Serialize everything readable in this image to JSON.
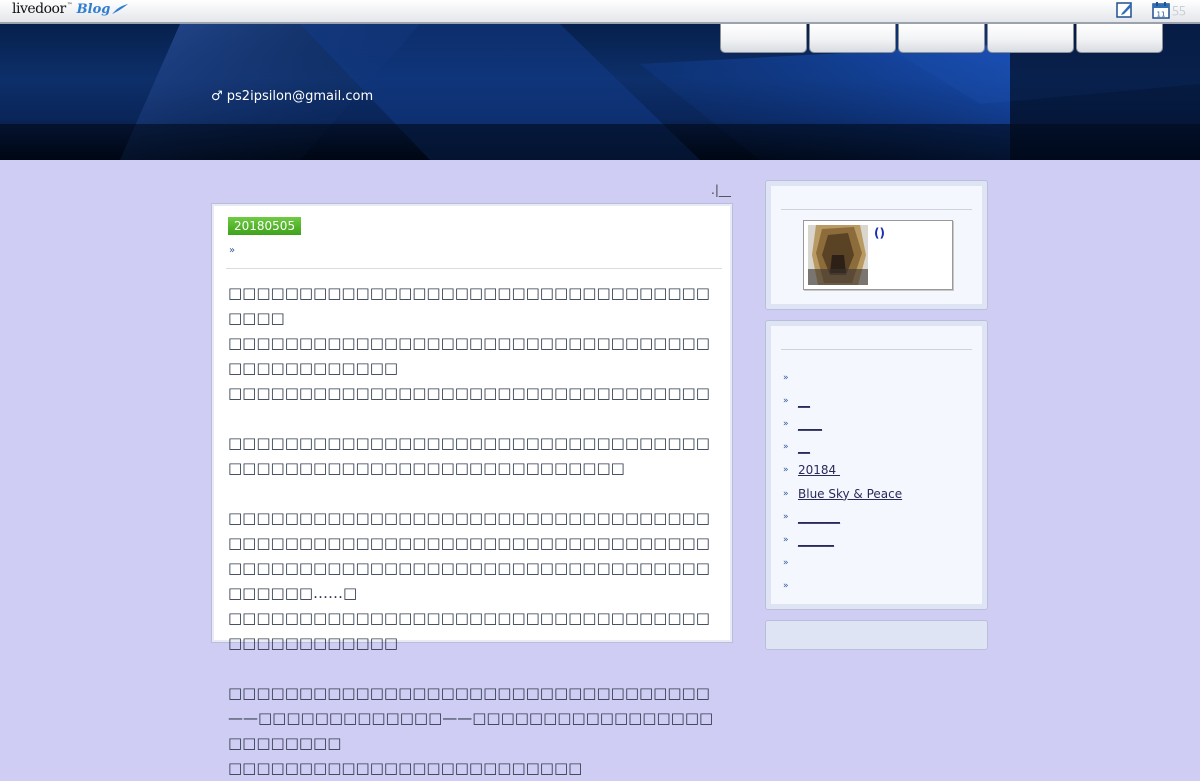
{
  "topbar": {
    "logo_main": "livedoor",
    "logo_tm": "™",
    "logo_blog": "Blog",
    "edit_icon": "edit-icon",
    "calendar_icon": "calendar-icon",
    "calendar_day": "11",
    "faded_text": "ƽƽ"
  },
  "header": {
    "email": "♂ ps2ipsilon@gmail.com",
    "nav_tabs": [
      "",
      "",
      "",
      "",
      ""
    ]
  },
  "breadcrumb": ".|__",
  "article": {
    "date": "20180505",
    "title_marker": "»",
    "paragraphs": [
      "□□□□□□□□□□□□□□□□□□□□□□□□□□□□□□□□□□□□□□\n□□□□□□□□□□□□□□□□□□□□□□□□□□□□□□□□□□□□□□□□□□□□□□\n□□□□□□□□□□□□□□□□□□□□□□□□□□□□□□□□□□",
      "□□□□□□□□□□□□□□□□□□□□□□□□□□□□□□□□□□□□□□□□□□□□□□□□□□□□□□□□□□□□□□",
      "□□□□□□□□□□□□□□□□□□□□□□□□□□□□□□□□□□□□□□□□□□□□□□□□□□□□□□□□□□□□□□□□□□□□□□□□□□□□□□□□□□□□□□□□□□□□□□□□□□□□□□□□□□□□……□\n□□□□□□□□□□□□□□□□□□□□□□□□□□□□□□□□□□□□□□□□□□□□□□",
      "□□□□□□□□□□□□□□□□□□□□□□□□□□□□□□□□□□——□□□□□□□□□□□□□——□□□□□□□□□□□□□□□□□□□□□□□□□\n□□□□□□□□□□□□□□□□□□□□□□□□□"
    ]
  },
  "sidebar": {
    "profile_name": "()",
    "links": [
      "",
      "__",
      "____",
      "__",
      "20184 ",
      "Blue Sky & Peace",
      "_______",
      "______",
      "",
      ""
    ]
  },
  "colors": {
    "page_bg": "#d0cdf4",
    "banner": "#0d2f6a",
    "date_badge": "#4ab22a",
    "link_arrow": "#2f5a9c"
  }
}
